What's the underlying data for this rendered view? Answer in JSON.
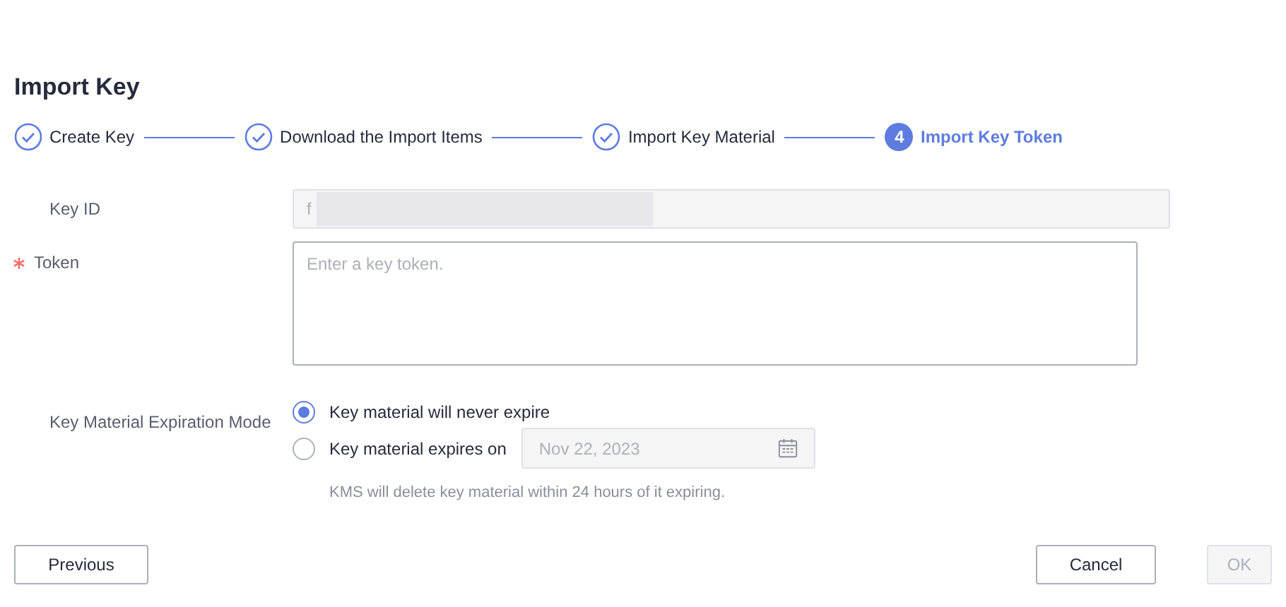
{
  "dialog": {
    "title": "Import Key"
  },
  "steps": [
    {
      "label": "Create Key",
      "completed": true,
      "selected": false
    },
    {
      "label": "Download the Import Items",
      "completed": true,
      "selected": false
    },
    {
      "label": "Import Key Material",
      "completed": true,
      "selected": false
    },
    {
      "label": "Import Key Token",
      "completed": false,
      "selected": true,
      "number": "4"
    }
  ],
  "form": {
    "key_id": {
      "label": "Key ID",
      "value": "f",
      "disabled": true
    },
    "token": {
      "label": "Token",
      "required": true,
      "placeholder": "Enter a key token."
    },
    "expiration": {
      "label": "Key Material Expiration Mode",
      "options": [
        {
          "label": "Key material will never expire",
          "selected": true
        },
        {
          "label": "Key material expires on",
          "selected": false,
          "date": "Nov 22, 2023"
        }
      ],
      "hint": "KMS will delete key material within 24 hours of it expiring."
    }
  },
  "buttons": [
    {
      "label": "Previous",
      "disabled": false
    },
    {
      "label": "Cancel",
      "disabled": false
    },
    {
      "label": "OK",
      "disabled": true
    }
  ]
}
